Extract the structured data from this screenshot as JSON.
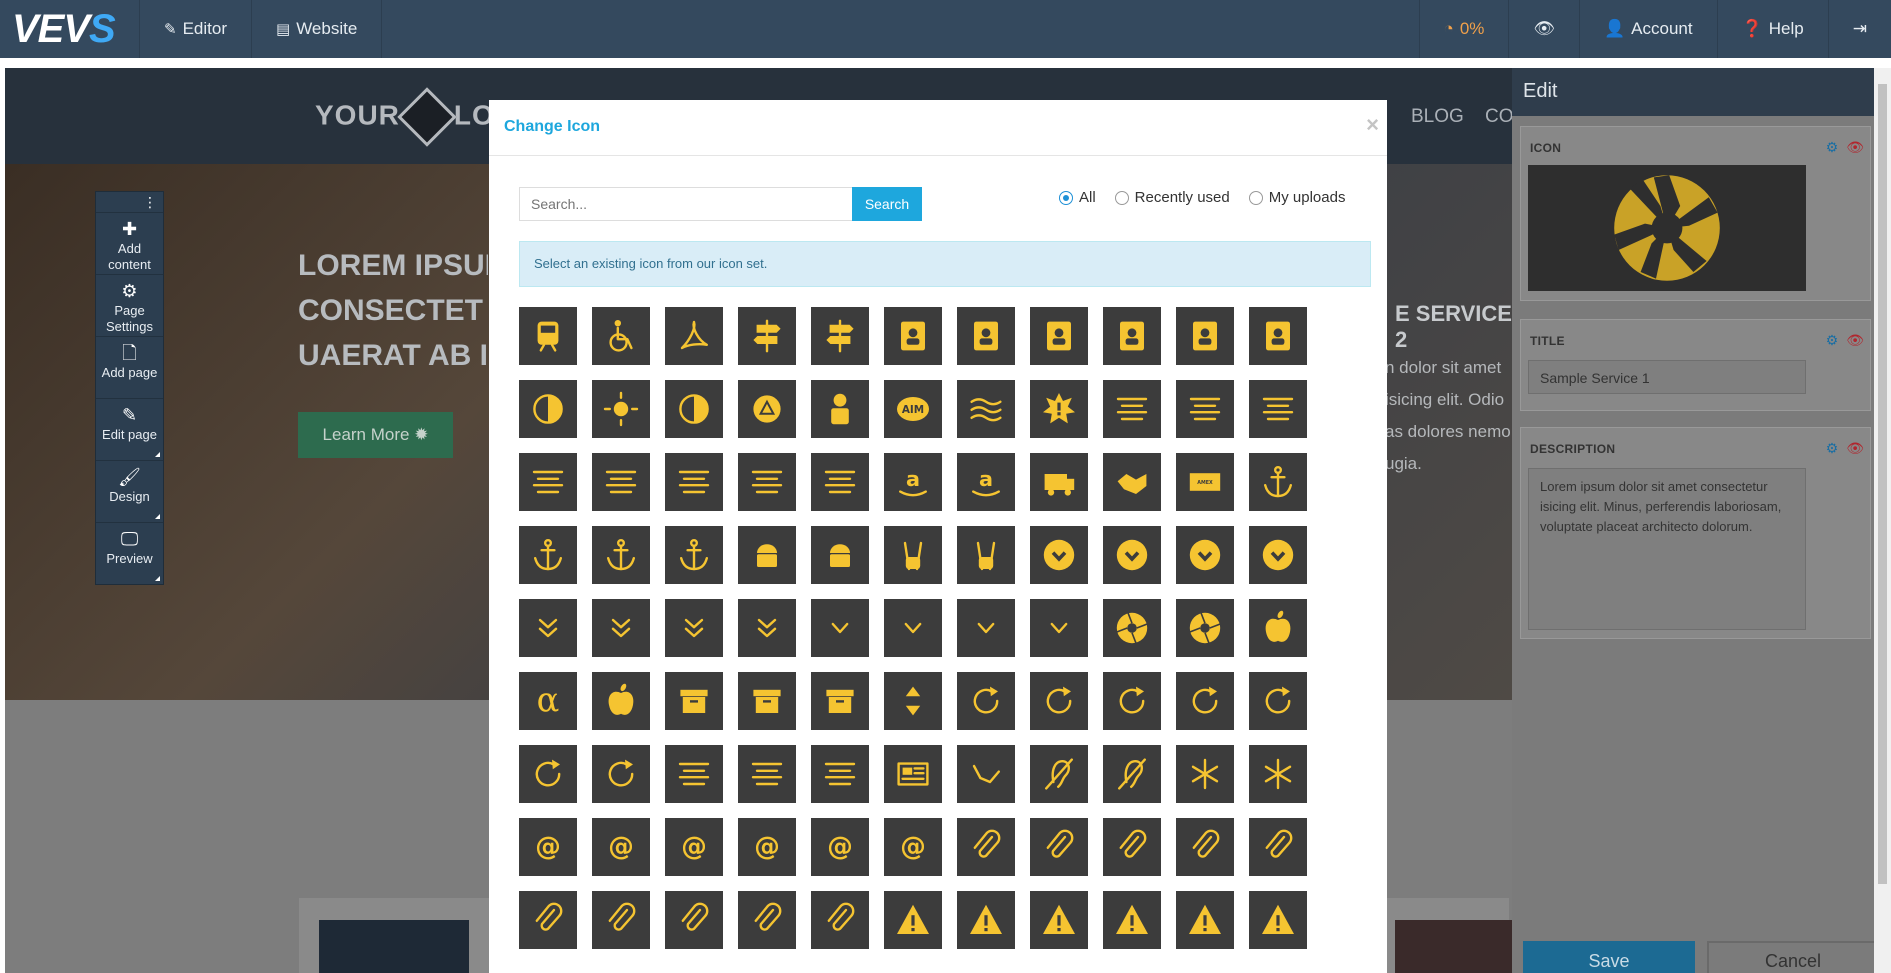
{
  "app": {
    "logo": "VEVS",
    "nav": [
      {
        "label": "Editor",
        "icon": "pencil-icon"
      },
      {
        "label": "Website",
        "icon": "list-icon"
      }
    ],
    "progress": "0%",
    "account": "Account",
    "help": "Help"
  },
  "site": {
    "logo_text_1": "YOUR",
    "logo_text_2": "LO",
    "nav": [
      "BLOG",
      "CO"
    ],
    "hero_lines": [
      "LOREM IPSUM",
      "CONSECTET",
      "UAERAT AB I"
    ],
    "learn_more": "Learn More",
    "service_title": "E SERVICE 2",
    "service_text": [
      "n dolor sit amet",
      "isicing elit. Odio",
      "as dolores nemo",
      "ugia."
    ]
  },
  "tools": [
    {
      "label": "Add content",
      "icon": "plus-icon"
    },
    {
      "label": "Page Settings",
      "icon": "gears-icon"
    },
    {
      "label": "Add page",
      "icon": "file-icon"
    },
    {
      "label": "Edit page",
      "icon": "pencil-icon"
    },
    {
      "label": "Design",
      "icon": "brush-icon"
    },
    {
      "label": "Preview",
      "icon": "monitor-icon"
    }
  ],
  "edit_panel": {
    "title": "Edit",
    "icon_label": "ICON",
    "title_label": "TITLE",
    "title_value": "Sample Service 1",
    "description_label": "DESCRIPTION",
    "description_value": "Lorem ipsum dolor sit amet consectetur isicing elit. Minus, perferendis laboriosam, voluptate placeat architecto dolorum.",
    "save": "Save",
    "cancel": "Cancel"
  },
  "modal": {
    "title": "Change Icon",
    "close": "×",
    "search_placeholder": "Search...",
    "search_button": "Search",
    "filters": [
      {
        "label": "All",
        "selected": true
      },
      {
        "label": "Recently used",
        "selected": false
      },
      {
        "label": "My uploads",
        "selected": false
      }
    ],
    "info": "Select an existing icon from our icon set.",
    "icon_color": "#f5c431",
    "icons": [
      "train",
      "wheelchair",
      "adobe",
      "signpost",
      "signs",
      "address-book",
      "address-book-o",
      "address-card-circle",
      "address-book-2",
      "id-card",
      "id-card-o",
      "adjust",
      "brightness",
      "contrast",
      "adn",
      "user",
      "aim",
      "water",
      "warning-burst",
      "align-center",
      "align-center-2",
      "align-justify",
      "align-justify-2",
      "align-left",
      "align-left-2",
      "align-right",
      "align-right-2",
      "amazon",
      "amazon-2",
      "ambulance",
      "handshake",
      "amex",
      "anchor",
      "anchor-2",
      "anchor-3",
      "anchor-4",
      "android",
      "android-2",
      "peace",
      "peace-2",
      "chevron-circle-down",
      "chevron-circle-left",
      "chevron-circle-right",
      "chevron-circle-up",
      "double-down",
      "double-left",
      "double-right",
      "double-up",
      "angle-down",
      "angle-left",
      "angle-right",
      "angle-up",
      "aperture",
      "aperture-2",
      "apple",
      "alpha",
      "apple-2",
      "archive-box",
      "archive",
      "archive-2",
      "sort",
      "redo",
      "refresh",
      "refresh-2",
      "refresh-3",
      "refresh-4",
      "refresh-5",
      "refresh-circle",
      "text-lines",
      "text-lines-2",
      "text-more",
      "newspaper",
      "shaka",
      "deaf",
      "hearing",
      "asterisk",
      "asterisk-2",
      "at",
      "at-bold",
      "at-heavy",
      "at-light",
      "at-2",
      "at-circle",
      "paperclip",
      "paperclip-2",
      "paperclip-3",
      "paperclip-4",
      "paperclip-5",
      "paperclip-6",
      "paperclip-7",
      "paperclip-8",
      "paperclip-circle",
      "paperclip-9",
      "alert",
      "alert-2",
      "alert-o",
      "alert-3",
      "alert-circle",
      "alert-4"
    ]
  }
}
